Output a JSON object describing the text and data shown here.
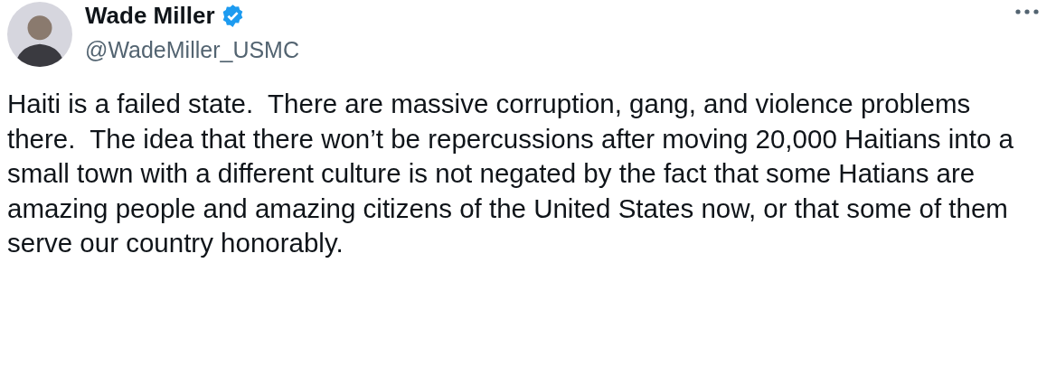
{
  "author": {
    "name": "Wade Miller",
    "verified": true,
    "handle": "@WadeMiller_USMC"
  },
  "tweet": {
    "text": "Haiti is a failed state.  There are massive corruption, gang, and violence problems there.  The idea that there won’t be repercussions after moving 20,000 Haitians into a small town with a different culture is not negated by the fact that some Hatians are amazing people and amazing citizens of the United States now, or that some of them serve our country honorably."
  }
}
